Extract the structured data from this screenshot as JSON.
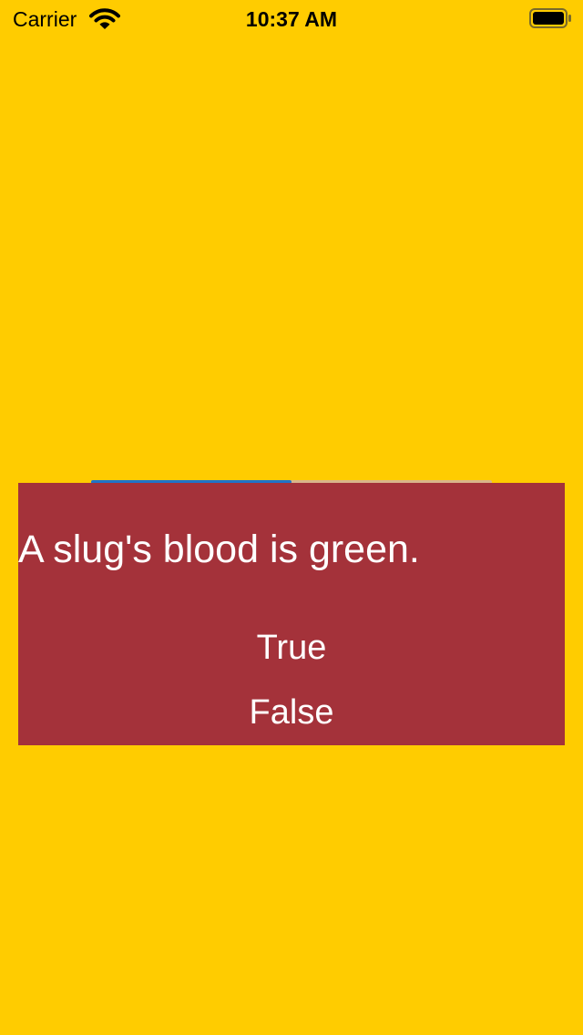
{
  "status_bar": {
    "carrier": "Carrier",
    "time": "10:37 AM",
    "wifi_icon": "wifi-icon",
    "battery_icon": "battery-icon"
  },
  "colors": {
    "background": "#FFCC00",
    "card": "#A4323A",
    "text": "#FFFFFF",
    "progress_fill": "#1F74C9",
    "progress_track": "#D9B58A"
  },
  "quiz": {
    "question": "A slug's blood is green.",
    "true_label": "True",
    "false_label": "False",
    "progress": 0.5
  }
}
